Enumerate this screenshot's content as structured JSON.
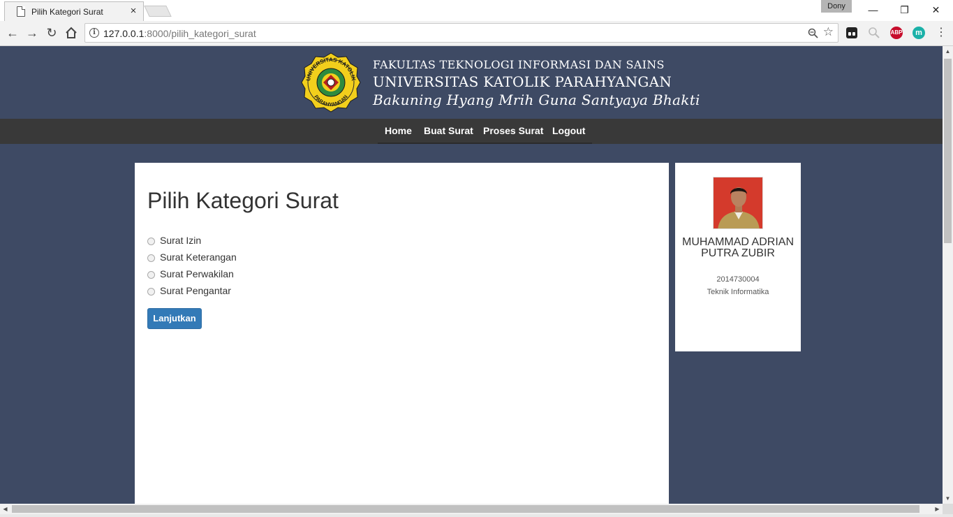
{
  "browser": {
    "tab_title": "Pilih Kategori Surat",
    "tab_close": "×",
    "user_name": "Dony",
    "url_host": "127.0.0.1",
    "url_path": ":8000/pilih_kategori_surat",
    "window_controls": {
      "minimize": "—",
      "restore": "❐",
      "close": "✕"
    },
    "extensions": [
      {
        "name": "abp-icon",
        "label": "ABP",
        "color": "#c70d2c"
      },
      {
        "name": "m-extension-icon",
        "label": "m",
        "color": "#1bb1a8"
      }
    ]
  },
  "header": {
    "faculty": "FAKULTAS TEKNOLOGI INFORMASI DAN SAINS",
    "university": "UNIVERSITAS KATOLIK PARAHYANGAN",
    "motto": "Bakuning Hyang Mrih Guna Santyaya Bhakti",
    "logo_text_top": "UNIVERSITAS KATOLIK",
    "logo_text_bottom": "PARAHYANGAN"
  },
  "nav": {
    "items": [
      "Home",
      "Buat Surat",
      "Proses Surat",
      "Logout"
    ]
  },
  "main": {
    "title": "Pilih Kategori Surat",
    "options": [
      "Surat Izin",
      "Surat Keterangan",
      "Surat Perwakilan",
      "Surat Pengantar"
    ],
    "submit_label": "Lanjutkan"
  },
  "profile": {
    "name": "MUHAMMAD ADRIAN PUTRA ZUBIR",
    "student_id": "2014730004",
    "major": "Teknik Informatika"
  },
  "colors": {
    "page_background": "#3e4a64",
    "navbar": "#393939",
    "button_primary": "#337ab7"
  }
}
